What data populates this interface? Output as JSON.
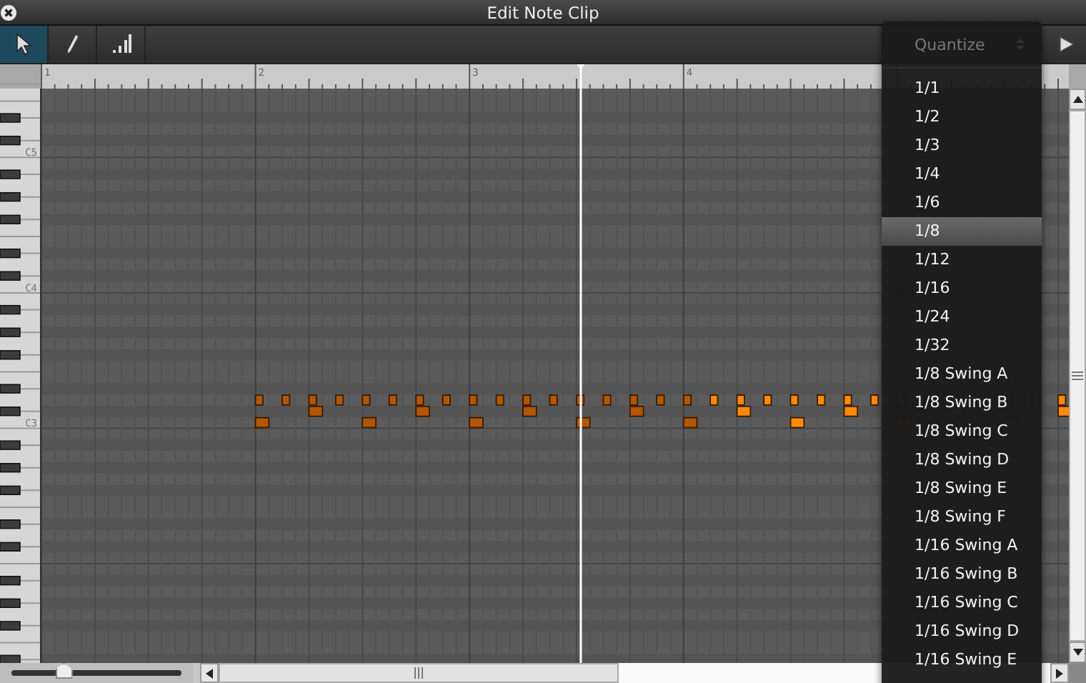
{
  "window": {
    "title": "Edit Note Clip"
  },
  "toolbar": {
    "tools": [
      {
        "kind": "pointer",
        "selected": true
      },
      {
        "kind": "pencil",
        "selected": false
      },
      {
        "kind": "velocity",
        "selected": false
      }
    ]
  },
  "piano_roll": {
    "ruler_labels": [
      "1",
      "2",
      "3",
      "4"
    ],
    "key_labels": [
      "C5",
      "C4",
      "C3"
    ],
    "notes": [
      {
        "selected": false
      },
      {
        "selected": false
      },
      {
        "selected": false
      },
      {
        "selected": false
      },
      {
        "selected": false
      },
      {
        "selected": false
      },
      {
        "selected": false
      },
      {
        "selected": false
      },
      {
        "selected": false
      },
      {
        "selected": false
      },
      {
        "selected": false
      },
      {
        "selected": false
      },
      {
        "selected": false
      },
      {
        "selected": false
      },
      {
        "selected": false
      },
      {
        "selected": false
      },
      {
        "selected": false
      },
      {
        "selected": true
      },
      {
        "selected": true
      },
      {
        "selected": true
      },
      {
        "selected": true
      },
      {
        "selected": true
      },
      {
        "selected": true
      },
      {
        "selected": true
      },
      {
        "selected": true
      },
      {
        "selected": false
      },
      {
        "selected": false
      },
      {
        "selected": false
      },
      {
        "selected": false
      },
      {
        "selected": true
      },
      {
        "selected": true
      },
      {
        "selected": true
      },
      {
        "selected": false
      },
      {
        "selected": false
      },
      {
        "selected": false
      },
      {
        "selected": false
      },
      {
        "selected": false
      },
      {
        "selected": true
      }
    ]
  },
  "zoom_slider": {
    "level": 0.3
  },
  "quantize_menu": {
    "placeholder": "Quantize",
    "items": [
      {
        "label": "1/1",
        "selected": false
      },
      {
        "label": "1/2",
        "selected": false
      },
      {
        "label": "1/3",
        "selected": false
      },
      {
        "label": "1/4",
        "selected": false
      },
      {
        "label": "1/6",
        "selected": false
      },
      {
        "label": "1/8",
        "selected": true
      },
      {
        "label": "1/12",
        "selected": false
      },
      {
        "label": "1/16",
        "selected": false
      },
      {
        "label": "1/24",
        "selected": false
      },
      {
        "label": "1/32",
        "selected": false
      },
      {
        "label": "1/8 Swing A",
        "selected": false
      },
      {
        "label": "1/8 Swing B",
        "selected": false
      },
      {
        "label": "1/8 Swing C",
        "selected": false
      },
      {
        "label": "1/8 Swing D",
        "selected": false
      },
      {
        "label": "1/8 Swing E",
        "selected": false
      },
      {
        "label": "1/8 Swing F",
        "selected": false
      },
      {
        "label": "1/16 Swing A",
        "selected": false
      },
      {
        "label": "1/16 Swing B",
        "selected": false
      },
      {
        "label": "1/16 Swing C",
        "selected": false
      },
      {
        "label": "1/16 Swing D",
        "selected": false
      },
      {
        "label": "1/16 Swing E",
        "selected": false
      }
    ]
  }
}
